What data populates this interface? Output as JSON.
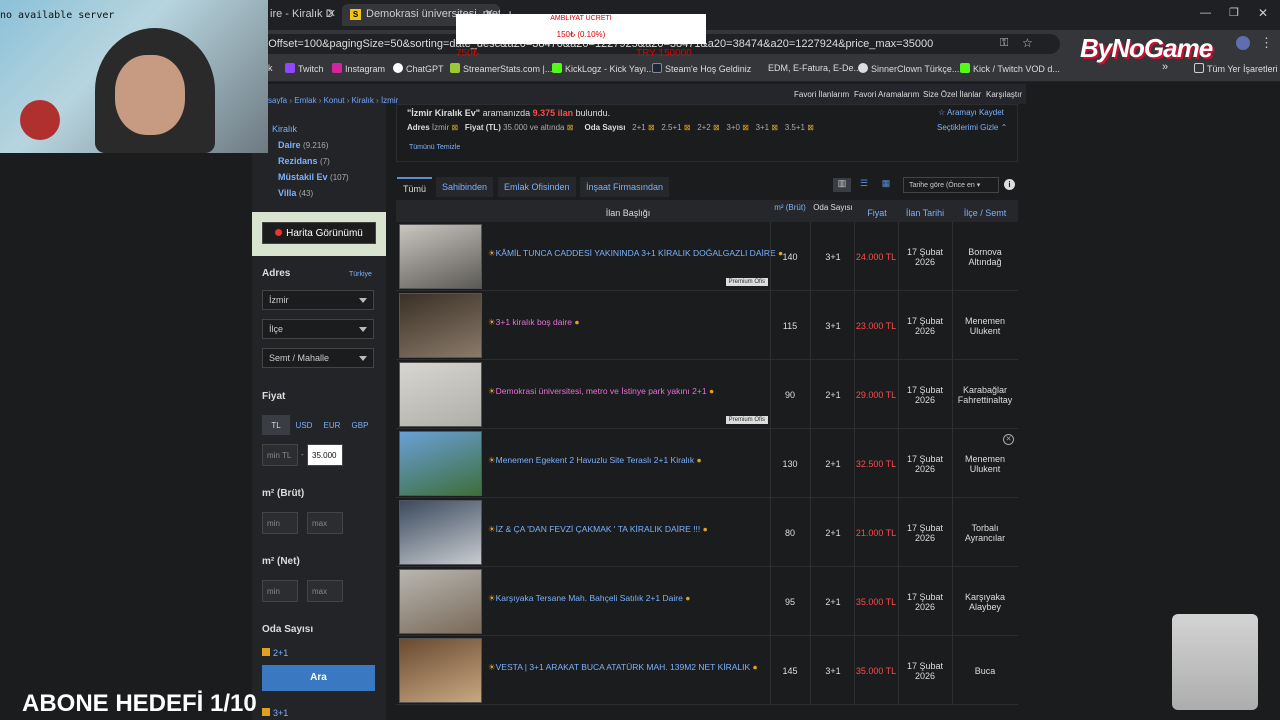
{
  "webcam": {
    "status_text": "no available server"
  },
  "tabs": [
    {
      "label": "ire - Kiralık D",
      "active": false
    },
    {
      "label": "Demokrasi üniversitesi, metro v",
      "active": true
    }
  ],
  "donation": {
    "title": "AMBLIYAT ÜCRETİ",
    "value": "150₺ (0.10%)",
    "left": "750₺",
    "right": "TRY 150000"
  },
  "url": "ngOffset=100&pagingSize=50&sorting=date_desc&a20=38470&a20=1227925&a20=38471&a20=38474&a20=1227924&price_max=35000",
  "bookmarks": [
    "Twitch",
    "Instagram",
    "ChatGPT",
    "StreamerStats.com |...",
    "KickLogz - Kick Yayı...",
    "Steam'e Hoş Geldiniz",
    "EDM, E-Fatura, E-De...",
    "SinnerClown Türkçe...",
    "Kick / Twitch VOD d...",
    "»",
    "Tüm Yer İşaretleri"
  ],
  "breadcrumb": [
    "sayfa",
    "Emlak",
    "Konut",
    "Kiralık",
    "İzmir"
  ],
  "toplinks": [
    "Favori İlanlarım",
    "Favori Aramalarım",
    "Size Özel İlanlar",
    "Karşılaştır"
  ],
  "search_summary": {
    "query": "\"İzmir Kiralık Ev\"",
    "mid": " aramanızda ",
    "count": "9.375 ilan",
    "end": " bulundu.",
    "save": "Aramayı Kaydet",
    "hide": "Seçtiklerimi Gizle",
    "clear": "Tümünü Temizle"
  },
  "filters": {
    "adres_label": "Adres",
    "adres_val": "İzmir",
    "fiyat_label": "Fiyat (TL)",
    "fiyat_val": "35.000 ve altında",
    "oda_label": "Oda Sayısı",
    "oda_vals": [
      "2+1",
      "2.5+1",
      "2+2",
      "3+0",
      "3+1",
      "3.5+1"
    ]
  },
  "left": {
    "category": "Kiralık",
    "sub": [
      {
        "name": "Daire",
        "count": "(9.216)"
      },
      {
        "name": "Rezidans",
        "count": "(7)"
      },
      {
        "name": "Müstakil Ev",
        "count": "(107)"
      },
      {
        "name": "Villa",
        "count": "(43)"
      }
    ],
    "map_button": "Harita Görünümü",
    "adres_title": "Adres",
    "adres_country": "Türkiye",
    "il": "İzmir",
    "ilce": "İlçe",
    "semt": "Semt / Mahalle",
    "fiyat_title": "Fiyat",
    "currencies": [
      "TL",
      "USD",
      "EUR",
      "GBP"
    ],
    "min_placeholder": "min TL",
    "max_value": "35.000",
    "brut_title": "m² (Brüt)",
    "net_title": "m² (Net)",
    "min": "min",
    "max": "max",
    "oda_title": "Oda Sayısı",
    "oda_first": "2+1",
    "oda_last": "3+1",
    "search_button": "Ara"
  },
  "tabs_main": [
    "Tümü",
    "Sahibinden",
    "Emlak Ofisinden",
    "İnşaat Firmasından"
  ],
  "sort": "Tarihe göre (Önce en",
  "headers": {
    "title": "İlan Başlığı",
    "m2": "m² (Brüt)",
    "oda": "Oda Sayısı",
    "fiyat": "Fiyat",
    "tarih": "İlan Tarihi",
    "ilce": "İlçe / Semt"
  },
  "listings": [
    {
      "title": "KÂMİL TUNCA CADDESİ YAKININDA 3+1 KİRALIK DOĞALGAZLI DAİRE",
      "m2": "140",
      "oda": "3+1",
      "price": "24.000 TL",
      "date1": "17 Şubat",
      "date2": "2026",
      "ilce1": "Bornova",
      "ilce2": "Altındağ",
      "premium": "Premium Ofis",
      "pink": false
    },
    {
      "title": "3+1 kiralık boş daire",
      "m2": "115",
      "oda": "3+1",
      "price": "23.000 TL",
      "date1": "17 Şubat",
      "date2": "2026",
      "ilce1": "Menemen",
      "ilce2": "Ulukent",
      "premium": "",
      "pink": true
    },
    {
      "title": "Demokrasi üniversitesi, metro ve İstinye park yakını 2+1",
      "m2": "90",
      "oda": "2+1",
      "price": "29.000 TL",
      "date1": "17 Şubat",
      "date2": "2026",
      "ilce1": "Karabağlar",
      "ilce2": "Fahrettinaltay",
      "premium": "Premium Ofis",
      "pink": true
    },
    {
      "title": "Menemen Egekent 2 Havuzlu Site Teraslı 2+1 Kiralık",
      "m2": "130",
      "oda": "2+1",
      "price": "32.500 TL",
      "date1": "17 Şubat",
      "date2": "2026",
      "ilce1": "Menemen",
      "ilce2": "Ulukent",
      "premium": "",
      "pink": false
    },
    {
      "title": "İZ & ÇA 'DAN FEVZİ ÇAKMAK ' TA KİRALIK DAİRE !!!",
      "m2": "80",
      "oda": "2+1",
      "price": "21.000 TL",
      "date1": "17 Şubat",
      "date2": "2026",
      "ilce1": "Torbalı",
      "ilce2": "Ayrancılar",
      "premium": "",
      "pink": false
    },
    {
      "title": "Karşıyaka Tersane Mah. Bahçeli Satılık 2+1 Daire",
      "m2": "95",
      "oda": "2+1",
      "price": "35.000 TL",
      "date1": "17 Şubat",
      "date2": "2026",
      "ilce1": "Karşıyaka",
      "ilce2": "Alaybey",
      "premium": "",
      "pink": false
    },
    {
      "title": "VESTA | 3+1 ARAKAT BUCA ATATÜRK MAH. 139M2 NET KİRALIK",
      "m2": "145",
      "oda": "3+1",
      "price": "35.000 TL",
      "date1": "17 Şubat",
      "date2": "2026",
      "ilce1": "Buca",
      "ilce2": "",
      "premium": "",
      "pink": false
    }
  ],
  "overlay": {
    "subgoal": "ABONE HEDEFİ 1/10",
    "logo": "ByNoGame"
  }
}
